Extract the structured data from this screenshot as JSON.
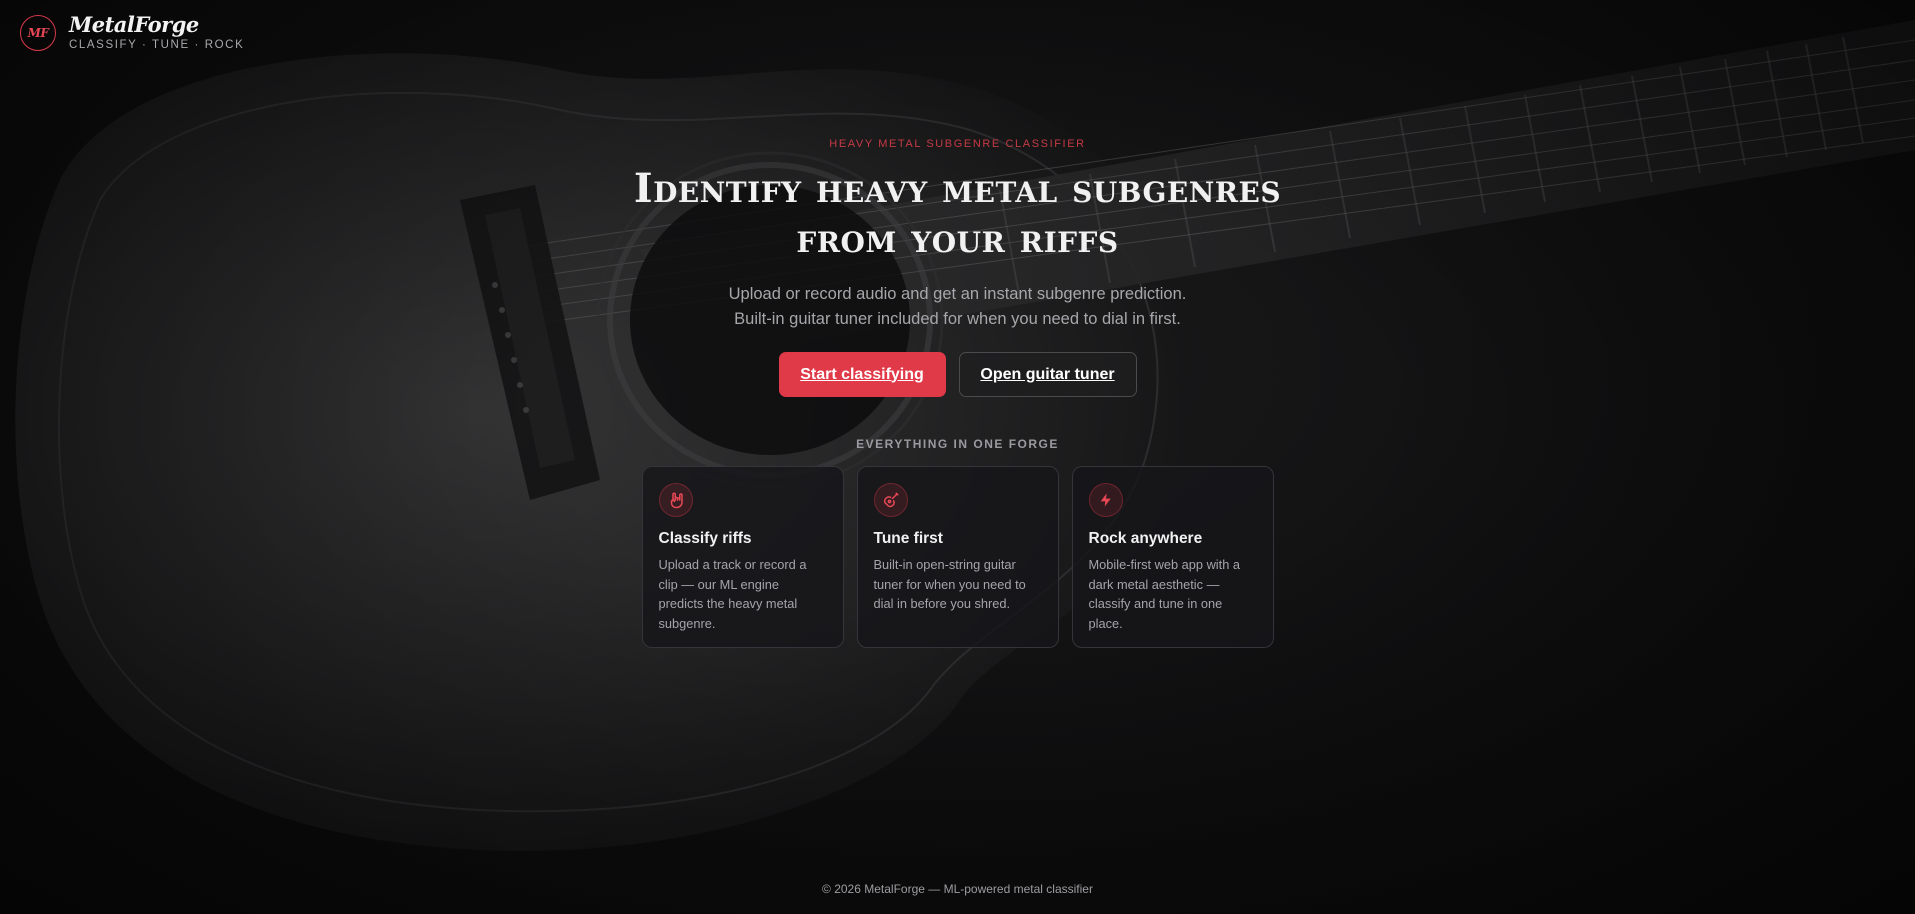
{
  "brand": {
    "logo_text": "MF",
    "name": "MetalForge",
    "tagline": "CLASSIFY · TUNE · ROCK"
  },
  "hero": {
    "eyebrow": "HEAVY METAL SUBGENRE CLASSIFIER",
    "headline_line1": "Identify heavy metal subgenres",
    "headline_line2": "from your riffs",
    "sub_line1": "Upload or record audio and get an instant subgenre prediction.",
    "sub_line2": "Built-in guitar tuner included for when you need to dial in first."
  },
  "actions": {
    "primary_label": "Start classifying",
    "secondary_label": "Open guitar tuner"
  },
  "features": {
    "section_label": "EVERYTHING IN ONE FORGE",
    "cards": [
      {
        "icon": "rock-hand-icon",
        "title": "Classify riffs",
        "description": "Upload a track or record a clip — our ML engine predicts the heavy metal subgenre."
      },
      {
        "icon": "guitar-icon",
        "title": "Tune first",
        "description": "Built-in open-string guitar tuner for when you need to dial in before you shred."
      },
      {
        "icon": "lightning-bolt-icon",
        "title": "Rock anywhere",
        "description": "Mobile-first web app with a dark metal aesthetic — classify and tune in one place."
      }
    ]
  },
  "footer": {
    "text": "© 2026 MetalForge — ML-powered metal classifier"
  },
  "colors": {
    "accent": "#e03a48",
    "background": "#0b0b0c",
    "card_border": "#34343a",
    "muted_text": "#a7a7ab"
  }
}
